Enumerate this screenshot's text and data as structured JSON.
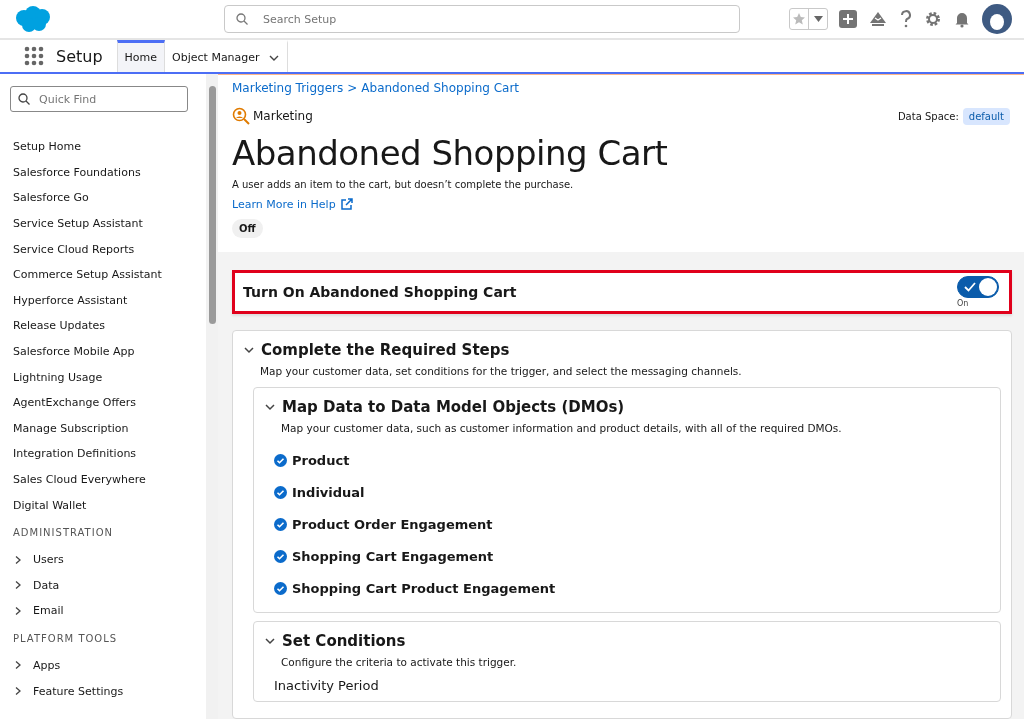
{
  "header": {
    "search_placeholder": "Search Setup"
  },
  "nav": {
    "app_name": "Setup",
    "tabs": [
      {
        "label": "Home",
        "selected": true
      },
      {
        "label": "Object Manager",
        "selected": false
      }
    ]
  },
  "sidebar": {
    "quick_find_placeholder": "Quick Find",
    "items": [
      "Setup Home",
      "Salesforce Foundations",
      "Salesforce Go",
      "Service Setup Assistant",
      "Service Cloud Reports",
      "Commerce Setup Assistant",
      "Hyperforce Assistant",
      "Release Updates",
      "Salesforce Mobile App",
      "Lightning Usage",
      "AgentExchange Offers",
      "Manage Subscription",
      "Integration Definitions",
      "Sales Cloud Everywhere",
      "Digital Wallet"
    ],
    "sections": [
      {
        "title": "ADMINISTRATION",
        "items": [
          {
            "label": "Users",
            "expanded": false
          },
          {
            "label": "Data",
            "expanded": false
          },
          {
            "label": "Email",
            "expanded": false
          }
        ]
      },
      {
        "title": "PLATFORM TOOLS",
        "items": [
          {
            "label": "Apps",
            "expanded": false
          },
          {
            "label": "Feature Settings",
            "expanded": false
          }
        ]
      }
    ]
  },
  "breadcrumb": {
    "items": [
      "Marketing Triggers",
      "Abandoned Shopping Cart"
    ],
    "separator": ">"
  },
  "category": "Marketing",
  "data_space": {
    "label": "Data Space:",
    "value": "default"
  },
  "title": "Abandoned Shopping Cart",
  "description": "A user adds an item to the cart, but doesn’t complete the purchase.",
  "help_link": "Learn More in Help",
  "status": "Off",
  "activation": {
    "label": "Turn On Abandoned Shopping Cart",
    "on": true,
    "state_label": "On"
  },
  "steps": {
    "title": "Complete the Required Steps",
    "description": "Map your customer data, set conditions for the trigger, and select the messaging channels.",
    "expanded": true,
    "sections": [
      {
        "title": "Map Data to Data Model Objects (DMOs)",
        "expanded": true,
        "description": "Map your customer data, such as customer information and product details, with all of the required DMOs.",
        "items": [
          {
            "label": "Product",
            "complete": true
          },
          {
            "label": "Individual",
            "complete": true
          },
          {
            "label": "Product Order Engagement",
            "complete": true
          },
          {
            "label": "Shopping Cart Engagement",
            "complete": true
          },
          {
            "label": "Shopping Cart Product Engagement",
            "complete": true
          }
        ]
      },
      {
        "title": "Set Conditions",
        "expanded": true,
        "description": "Configure the criteria to activate this trigger.",
        "field_label": "Inactivity Period"
      }
    ]
  }
}
